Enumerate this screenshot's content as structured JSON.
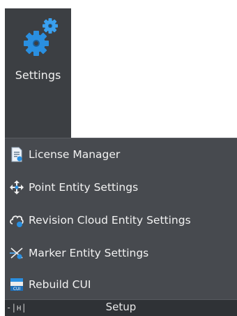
{
  "ribbon": {
    "settings_button": {
      "label": "Settings",
      "icon": "gears-icon"
    }
  },
  "menu": {
    "items": [
      {
        "label": "License Manager",
        "icon": "license-document-icon"
      },
      {
        "label": "Point Entity Settings",
        "icon": "point-move-icon"
      },
      {
        "label": "Revision Cloud Entity Settings",
        "icon": "revision-cloud-icon"
      },
      {
        "label": "Marker Entity Settings",
        "icon": "marker-icon"
      },
      {
        "label": "Rebuild CUI",
        "icon": "cui-icon"
      }
    ]
  },
  "panel": {
    "title": "Setup",
    "pin_glyph": "-|н|"
  },
  "colors": {
    "accent_blue": "#2a8fe0",
    "panel_bg": "#474a4f",
    "button_bg": "#3c3f43",
    "footer_bg": "#2f3236"
  }
}
